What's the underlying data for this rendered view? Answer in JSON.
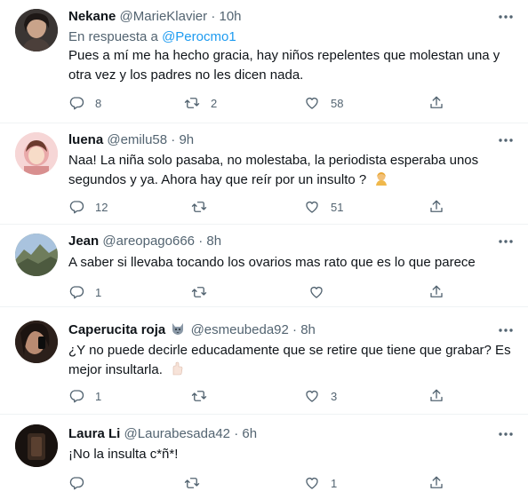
{
  "tweets": [
    {
      "name": "Nekane",
      "handle": "@MarieKlavier",
      "sep": "·",
      "time": "10h",
      "reply_prefix": "En respuesta a ",
      "reply_handle": "@Perocmo1",
      "text_line1": "Pues a mí me ha hecho gracia, hay niños repelentes que molestan una y",
      "text_line2": "otra vez y los padres no les dicen nada.",
      "replies": "8",
      "retweets": "2",
      "likes": "58",
      "avatar_color": "#2b2b2b"
    },
    {
      "name": "luena",
      "handle": "@emilu58",
      "sep": "·",
      "time": "9h",
      "text_line1": "Naa! La niña solo pasaba, no molestaba, la periodista esperaba unos",
      "text_line2": "segundos y ya. Ahora hay que reír por un insulto ?",
      "emoji": "person-facepalming",
      "replies": "12",
      "retweets": "",
      "likes": "51",
      "avatar_color": "#f4c9c9"
    },
    {
      "name": "Jean",
      "handle": "@areopago666",
      "sep": "·",
      "time": "8h",
      "text_line1": "A saber si llevaba tocando los ovarios mas rato que es lo que parece",
      "replies": "1",
      "retweets": "",
      "likes": "",
      "avatar_color": "#7a8a6a"
    },
    {
      "name": "Caperucita roja",
      "name_emoji": "wolf",
      "handle": "@esmeubeda92",
      "sep": "·",
      "time": "8h",
      "text_line1": "¿Y no puede decirle educadamente que se retire que tiene que grabar? Es",
      "text_line2": "mejor insultarla.",
      "emoji": "thumb-gesture",
      "replies": "1",
      "retweets": "",
      "likes": "3",
      "avatar_color": "#3a2a22"
    },
    {
      "name": "Laura Li",
      "handle": "@Laurabesada42",
      "sep": "·",
      "time": "6h",
      "text_line1": "¡No la insulta c*ñ*!",
      "replies": "",
      "retweets": "",
      "likes": "1",
      "avatar_color": "#1a1410"
    }
  ],
  "icons": {
    "reply": "reply-icon",
    "retweet": "retweet-icon",
    "like": "heart-icon",
    "share": "share-icon",
    "more": "more-icon"
  },
  "colors": {
    "link": "#1d9bf0",
    "secondary": "#536471",
    "text": "#0f1419",
    "divider": "#eff3f4"
  }
}
